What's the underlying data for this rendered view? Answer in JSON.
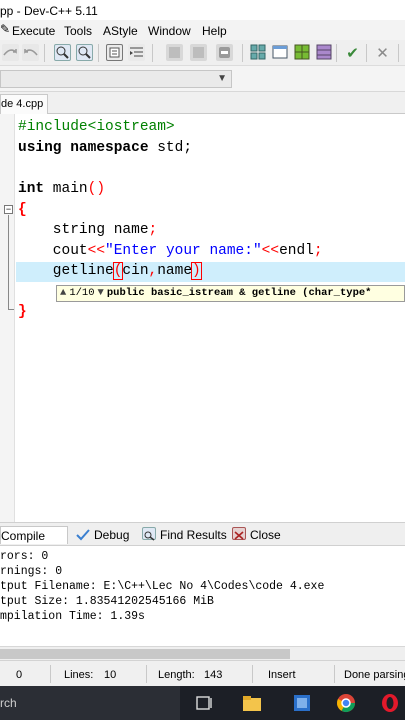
{
  "window": {
    "title": "pp - Dev-C++ 5.11"
  },
  "menu": {
    "items": [
      "Execute",
      "Tools",
      "AStyle",
      "Window",
      "Help"
    ]
  },
  "toolbar": {
    "icons": [
      "find-icon",
      "find-replace-icon",
      "module-icon",
      "indent-icon",
      "compile-icon",
      "compile-run-icon",
      "rebuild-icon",
      "debug-icon",
      "check-icon",
      "close-icon"
    ],
    "close_glyph": "✕",
    "check_glyph": "✔"
  },
  "toolbar2": {
    "dropdown_arrow": "▼"
  },
  "tabs": {
    "active_file": "de 4.cpp"
  },
  "editor": {
    "lines": [
      {
        "parts": [
          {
            "t": "#include<iostream>",
            "c": "pp"
          }
        ]
      },
      {
        "parts": [
          {
            "t": "using namespace",
            "c": "kw"
          },
          {
            "t": " std;",
            "c": ""
          }
        ]
      },
      {
        "parts": [
          {
            "t": "",
            "c": ""
          }
        ]
      },
      {
        "parts": [
          {
            "t": "int",
            "c": "kw"
          },
          {
            "t": " main",
            "c": ""
          },
          {
            "t": "()",
            "c": "op"
          }
        ]
      },
      {
        "parts": [
          {
            "t": "{",
            "c": "brace"
          }
        ]
      },
      {
        "parts": [
          {
            "t": "    string name",
            "c": ""
          },
          {
            "t": ";",
            "c": "op"
          }
        ]
      },
      {
        "parts": [
          {
            "t": "    cout",
            "c": ""
          },
          {
            "t": "<<",
            "c": "op"
          },
          {
            "t": "\"Enter your name:\"",
            "c": "str"
          },
          {
            "t": "<<",
            "c": "op"
          },
          {
            "t": "endl",
            "c": ""
          },
          {
            "t": ";",
            "c": "op"
          }
        ]
      },
      {
        "parts": [
          {
            "t": "    getline",
            "c": ""
          },
          {
            "t": "(",
            "c": "op paren-hl"
          },
          {
            "t": "cin",
            "c": ""
          },
          {
            "t": ",",
            "c": "op"
          },
          {
            "t": "name",
            "c": ""
          },
          {
            "t": ")",
            "c": "op paren-hl"
          }
        ]
      },
      {
        "parts": [
          {
            "t": "",
            "c": ""
          }
        ]
      },
      {
        "parts": [
          {
            "t": "}",
            "c": "brace"
          }
        ]
      }
    ],
    "calltip": {
      "counter": "1/10",
      "signature": "public basic_istream & getline (char_type*"
    }
  },
  "bottom_panel": {
    "tabs": [
      {
        "label": "Compile Log",
        "active": true
      },
      {
        "label": "Debug",
        "active": false
      },
      {
        "label": "Find Results",
        "active": false
      },
      {
        "label": "Close",
        "active": false
      }
    ],
    "log": [
      "rors: 0",
      "rnings: 0",
      "tput Filename: E:\\C++\\Lec No 4\\Codes\\code 4.exe",
      "tput Size: 1.83541202545166 MiB",
      "mpilation Time: 1.39s"
    ]
  },
  "statusbar": {
    "col": "0",
    "lines_label": "Lines:",
    "lines_value": "10",
    "length_label": "Length:",
    "length_value": "143",
    "mode": "Insert",
    "status": "Done parsing"
  },
  "taskbar": {
    "search_text": "rch"
  },
  "colors": {
    "accent": "#cfeefc",
    "keyword": "#000000",
    "preprocessor": "#008000",
    "string": "#0000ff",
    "operator": "#ff0000",
    "taskbar": "#1c1f26"
  }
}
